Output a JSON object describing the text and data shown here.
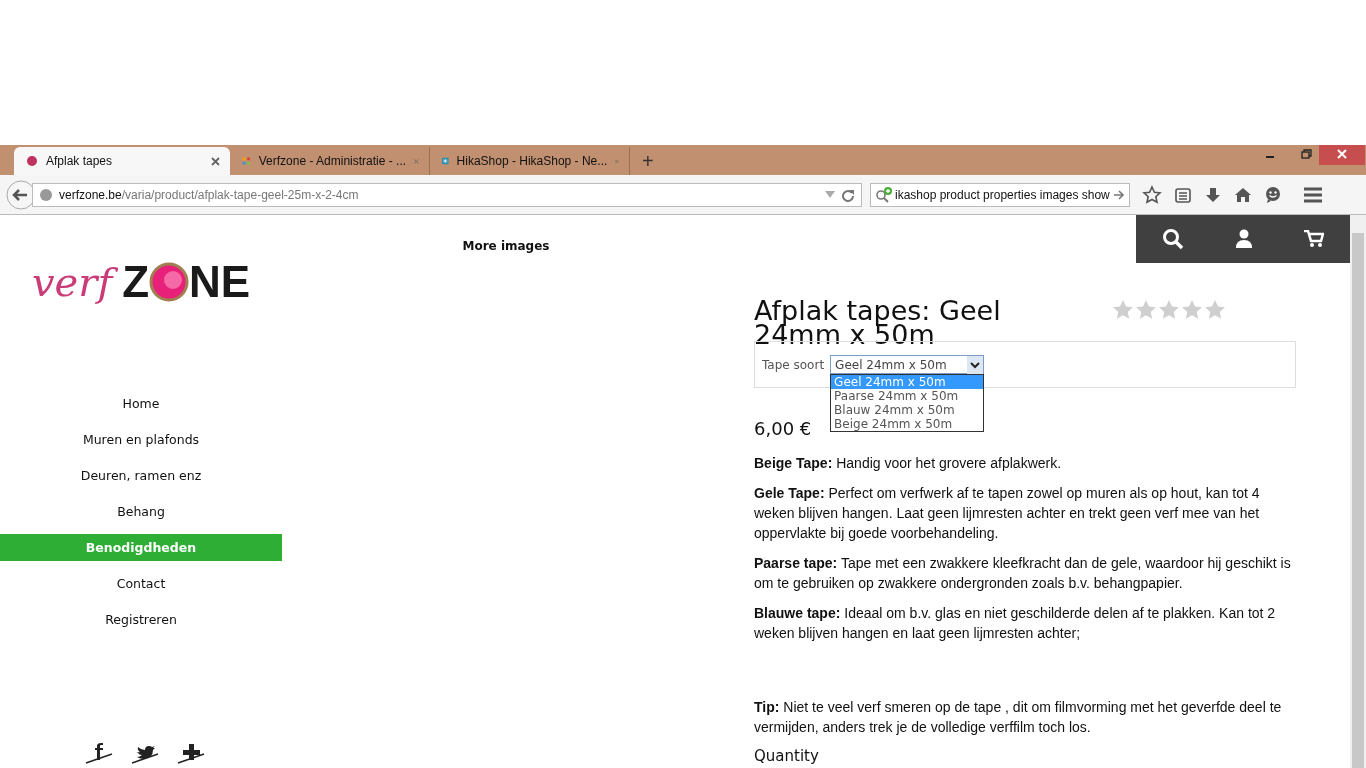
{
  "browser": {
    "tabs": [
      {
        "title": "Afplak tapes",
        "selected": true,
        "kind": "dot"
      },
      {
        "title": "Verfzone - Administratie - ...",
        "selected": false,
        "kind": "joomla"
      },
      {
        "title": "HikaShop - HikaShop - Ne...",
        "selected": false,
        "kind": "hika"
      }
    ],
    "new_tab": "+",
    "url": {
      "host": "verfzone.be",
      "path": "/varia/product/afplak-tape-geel-25m-x-2-4cm"
    },
    "search": {
      "value": "ikashop product properties images show"
    }
  },
  "logo": {
    "script": "verf",
    "bold_before": "Z",
    "bold_after": "NE"
  },
  "nav": [
    {
      "label": "Home",
      "selected": false
    },
    {
      "label": "Muren en plafonds",
      "selected": false
    },
    {
      "label": "Deuren, ramen enz",
      "selected": false
    },
    {
      "label": "Behang",
      "selected": false
    },
    {
      "label": "Benodigdheden",
      "selected": true
    },
    {
      "label": "Contact",
      "selected": false
    },
    {
      "label": "Registreren",
      "selected": false
    }
  ],
  "social": [
    {
      "kind": "facebook"
    },
    {
      "kind": "twitter"
    },
    {
      "kind": "plus"
    }
  ],
  "more_images": "More images",
  "product": {
    "title": "Afplak tapes: Geel 24mm x 50m",
    "stars": 0,
    "option": {
      "label": "Tape soort",
      "value": "Geel 24mm x 50m",
      "choices": [
        {
          "label": "Geel 24mm x 50m",
          "selected": true
        },
        {
          "label": "Paarse 24mm x 50m",
          "selected": false
        },
        {
          "label": "Blauw 24mm x 50m",
          "selected": false
        },
        {
          "label": "Beige 24mm x 50m",
          "selected": false
        }
      ]
    },
    "price": "6,00 €",
    "description": [
      "**Beige Tape:** Handig voor het grovere afplakwerk.",
      "**Gele Tape:** Perfect om verfwerk af te tapen zowel op muren als op hout, kan tot 4 weken blijven hangen. Laat geen lijmresten achter en trekt geen verf mee van het oppervlakte bij goede voorbehandeling.",
      "**Paarse tape:** Tape met een zwakkere kleefkracht dan de gele, waardoor hij geschikt is om te gebruiken op zwakkere ondergronden zoals b.v. behangpapier.",
      "**Blauwe tape:** Ideaal om b.v. glas en niet geschilderde delen af te plakken. Kan tot 2 weken blijven hangen en laat geen lijmresten achter;"
    ],
    "tip": "**Tip:** Niet te veel verf smeren op de tape , dit om filmvorming met het geverfde deel te vermijden, anders trek je de volledige verffilm toch los.",
    "quantity_label": "Quantity"
  }
}
